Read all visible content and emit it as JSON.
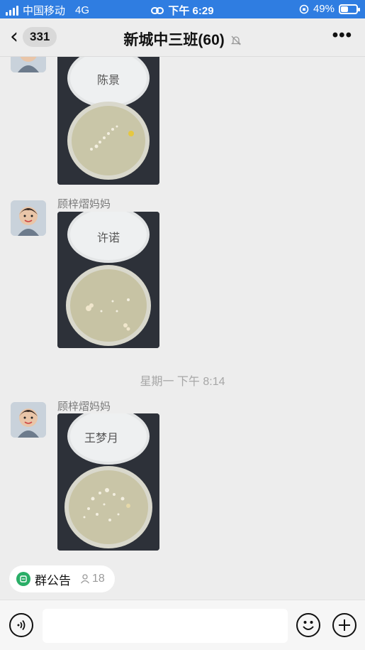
{
  "status_bar": {
    "carrier": "中国移动",
    "network": "4G",
    "time": "下午 6:29",
    "battery_percent": "49%",
    "battery_level": 0.49
  },
  "nav": {
    "unread_count": "331",
    "title": "新城中三班(60)",
    "back_icon": "chevron-left-icon",
    "mute_icon": "bell-off-icon",
    "more_icon": "more-icon"
  },
  "messages": [
    {
      "sender": "",
      "plate_label": "陈景",
      "type": "image"
    },
    {
      "sender": "顾梓熠妈妈",
      "plate_label": "许诺",
      "type": "image"
    },
    {
      "timestamp": "星期一 下午 8:14"
    },
    {
      "sender": "顾梓熠妈妈",
      "plate_label": "王梦月",
      "type": "image"
    }
  ],
  "notice": {
    "label": "群公告",
    "member_count": "18",
    "icon": "notice-icon"
  },
  "input": {
    "placeholder": "",
    "voice_icon": "voice-icon",
    "emoji_icon": "emoji-icon",
    "plus_icon": "plus-icon"
  },
  "colors": {
    "status_bar": "#2f7de1",
    "notice_green": "#2aae67",
    "chat_bg": "#ededed"
  }
}
